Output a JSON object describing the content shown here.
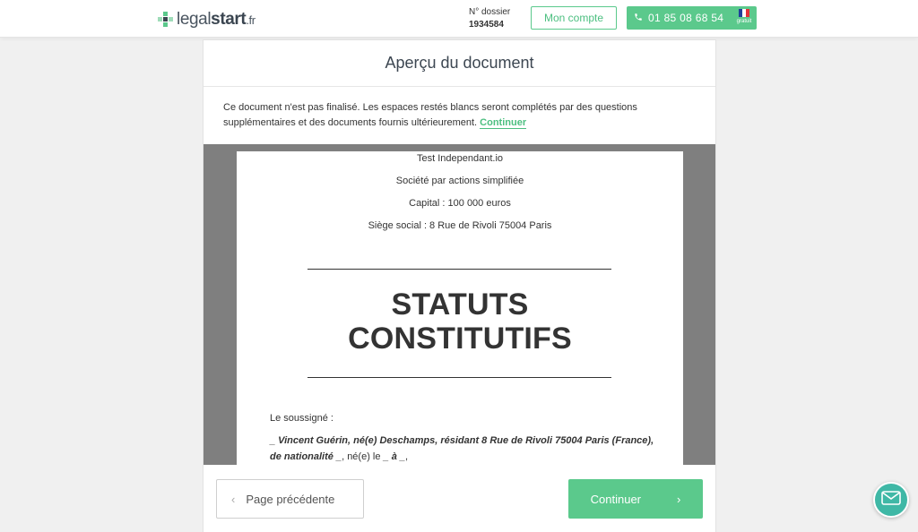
{
  "header": {
    "logo": {
      "prefix": "legal",
      "bold": "start",
      "tld": ".fr"
    },
    "dossier": {
      "label": "N° dossier",
      "number": "1934584"
    },
    "account_button": "Mon compte",
    "phone": {
      "number": "01 85 08 68 54",
      "badge": "gratuit"
    }
  },
  "card": {
    "title": "Aperçu du document",
    "notice": {
      "text": "Ce document n'est pas finalisé. Les espaces restés blancs seront complétés par des questions supplémentaires et des documents fournis ultérieurement.",
      "link": "Continuer"
    }
  },
  "document": {
    "company": "Test Independant.io",
    "form": "Société par actions simplifiée",
    "capital": "Capital : 100 000 euros",
    "seat": "Siège social : 8 Rue de Rivoli 75004 Paris",
    "title_line1": "STATUTS",
    "title_line2": "CONSTITUTIFS",
    "intro": "Le soussigné :",
    "person_bold": "_ Vincent Guérin, né(e) Deschamps, résidant 8 Rue de Rivoli 75004 Paris (France), de nationalité _",
    "person_tail": ", né(e) le ",
    "person_date": "_ à _",
    "person_end": ","
  },
  "footer": {
    "prev": "Page précédente",
    "next": "Continuer"
  },
  "colors": {
    "accent": "#5bc98c",
    "chat": "#3fb8a6",
    "viewer_bg": "#7f7f7f"
  },
  "icons": [
    "logo-icon",
    "phone-icon",
    "french-flag-icon",
    "chevron-left-icon",
    "chevron-right-icon",
    "mail-icon"
  ]
}
